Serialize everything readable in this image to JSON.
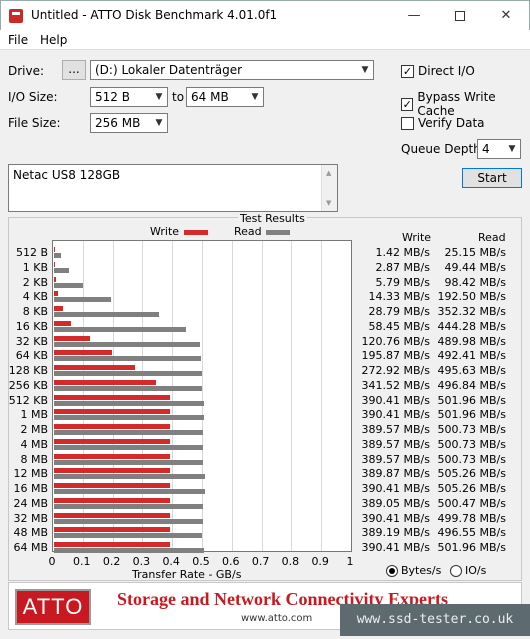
{
  "window": {
    "title": "Untitled - ATTO Disk Benchmark 4.01.0f1",
    "minimize": "—",
    "close": "✕"
  },
  "menu": {
    "file": "File",
    "help": "Help"
  },
  "form": {
    "drive_label": "Drive:",
    "browse_label": "...",
    "drive_value": "(D:) Lokaler Datenträger",
    "io_size_label": "I/O Size:",
    "io_from": "512 B",
    "to_label": "to",
    "io_to": "64 MB",
    "file_size_label": "File Size:",
    "file_size": "256 MB",
    "direct_io_label": "Direct I/O",
    "direct_io_checked": true,
    "bypass_cache_label": "Bypass Write Cache",
    "bypass_cache_checked": true,
    "verify_label": "Verify Data",
    "verify_checked": false,
    "queue_label": "Queue Depth:",
    "queue_value": "4",
    "start_label": "Start",
    "description": "Netac US8 128GB",
    "check_mark": "✓"
  },
  "results": {
    "title": "Test Results",
    "legend_write": "Write",
    "legend_read": "Read",
    "col_write": "Write",
    "col_read": "Read",
    "xlabel": "Transfer Rate - GB/s",
    "unit_bytes": "Bytes/s",
    "unit_io": "IO/s",
    "bytes_selected": true
  },
  "chart_data": {
    "type": "bar",
    "orientation": "horizontal",
    "xlabel": "Transfer Rate - GB/s",
    "xlim": [
      0,
      1
    ],
    "xticks": [
      "0",
      "0.1",
      "0.2",
      "0.3",
      "0.4",
      "0.5",
      "0.6",
      "0.7",
      "0.8",
      "0.9",
      "1"
    ],
    "grid": true,
    "categories": [
      "512 B",
      "1 KB",
      "2 KB",
      "4 KB",
      "8 KB",
      "16 KB",
      "32 KB",
      "64 KB",
      "128 KB",
      "256 KB",
      "512 KB",
      "1 MB",
      "2 MB",
      "4 MB",
      "8 MB",
      "12 MB",
      "16 MB",
      "24 MB",
      "32 MB",
      "48 MB",
      "64 MB"
    ],
    "series": [
      {
        "name": "Write",
        "color": "#d42a2a",
        "values": [
          0.00142,
          0.00287,
          0.00579,
          0.01433,
          0.02879,
          0.05845,
          0.12076,
          0.19587,
          0.27292,
          0.34152,
          0.39041,
          0.39041,
          0.38957,
          0.38957,
          0.38957,
          0.38987,
          0.39041,
          0.38905,
          0.39041,
          0.38919,
          0.39041
        ],
        "labels": [
          "1.42 MB/s",
          "2.87 MB/s",
          "5.79 MB/s",
          "14.33 MB/s",
          "28.79 MB/s",
          "58.45 MB/s",
          "120.76 MB/s",
          "195.87 MB/s",
          "272.92 MB/s",
          "341.52 MB/s",
          "390.41 MB/s",
          "390.41 MB/s",
          "389.57 MB/s",
          "389.57 MB/s",
          "389.57 MB/s",
          "389.87 MB/s",
          "390.41 MB/s",
          "389.05 MB/s",
          "390.41 MB/s",
          "389.19 MB/s",
          "390.41 MB/s"
        ]
      },
      {
        "name": "Read",
        "color": "#808080",
        "values": [
          0.02515,
          0.04944,
          0.09842,
          0.1925,
          0.35232,
          0.44428,
          0.48998,
          0.49241,
          0.49563,
          0.49684,
          0.50196,
          0.50196,
          0.50073,
          0.50073,
          0.50073,
          0.50526,
          0.50526,
          0.50047,
          0.49978,
          0.49655,
          0.50196
        ],
        "labels": [
          "25.15 MB/s",
          "49.44 MB/s",
          "98.42 MB/s",
          "192.50 MB/s",
          "352.32 MB/s",
          "444.28 MB/s",
          "489.98 MB/s",
          "492.41 MB/s",
          "495.63 MB/s",
          "496.84 MB/s",
          "501.96 MB/s",
          "501.96 MB/s",
          "500.73 MB/s",
          "500.73 MB/s",
          "500.73 MB/s",
          "505.26 MB/s",
          "505.26 MB/s",
          "500.47 MB/s",
          "499.78 MB/s",
          "496.55 MB/s",
          "501.96 MB/s"
        ]
      }
    ]
  },
  "banner": {
    "logo": "ATTO",
    "tagline": "Storage and Network Connectivity Experts",
    "url": "www.atto.com"
  },
  "watermark": "www.ssd-tester.co.uk"
}
